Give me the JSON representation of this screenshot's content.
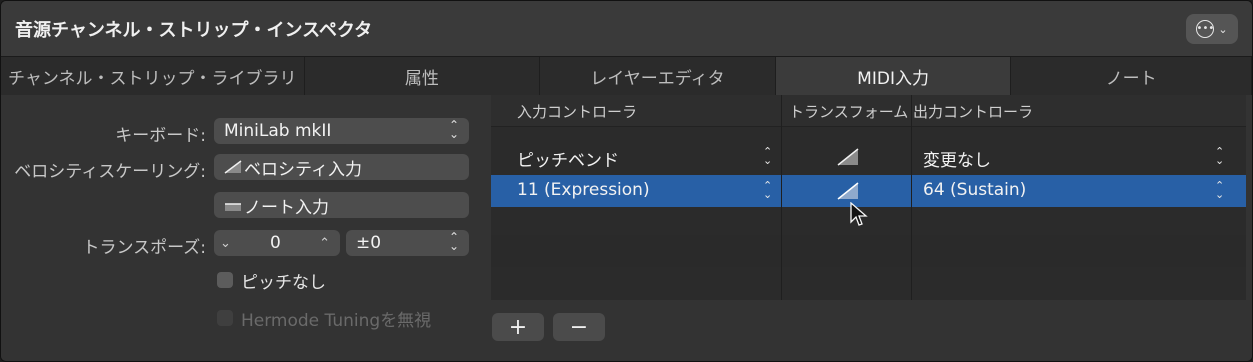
{
  "window": {
    "title": "音源チャンネル・ストリップ・インスペクタ"
  },
  "tabs": [
    {
      "label": "チャンネル・ストリップ・ライブラリ"
    },
    {
      "label": "属性"
    },
    {
      "label": "レイヤーエディタ"
    },
    {
      "label": "MIDI入力",
      "active": true
    },
    {
      "label": "ノート"
    }
  ],
  "settings": {
    "keyboard_label": "キーボード:",
    "keyboard_value": "MiniLab mkII",
    "velocity_label": "ベロシティスケーリング:",
    "velocity_value": "ベロシティ入力",
    "note_value": "ノート入力",
    "transpose_label": "トランスポーズ:",
    "transpose_value": "0",
    "transpose_offset": "±0",
    "no_pitch_label": "ピッチなし",
    "hermode_label": "Hermode Tuningを無視"
  },
  "table": {
    "headers": [
      "入力コントローラ",
      "トランスフォーム",
      "出力コントローラ"
    ],
    "rows": [
      {
        "input": "ピッチベンド",
        "output": "変更なし",
        "selected": false
      },
      {
        "input": "11 (Expression)",
        "output": "64 (Sustain)",
        "selected": true
      }
    ]
  },
  "buttons": {
    "add": "+",
    "remove": "−"
  },
  "colors": {
    "selection": "#2860a6",
    "background": "#2f2f2f"
  }
}
